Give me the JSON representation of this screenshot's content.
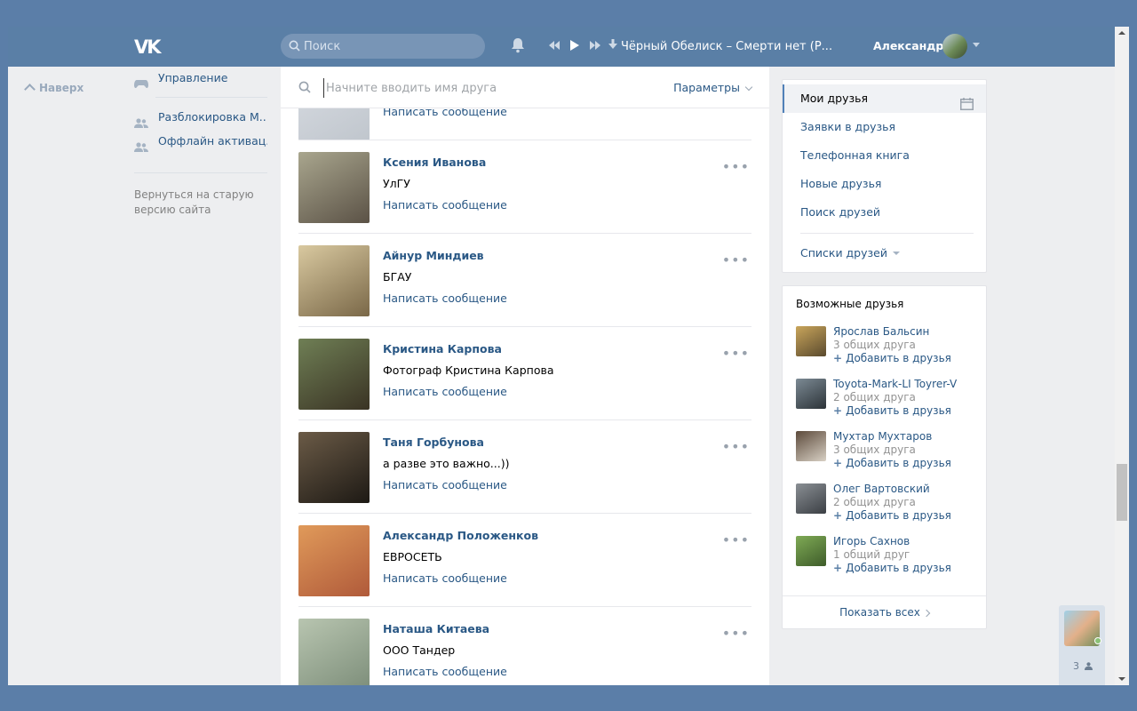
{
  "header": {
    "logo": "VK",
    "search_placeholder": "Поиск",
    "track": "Чёрный Обелиск – Смерти нет (Р...",
    "username": "Александр"
  },
  "left_menu": {
    "back_to_top": "Наверх",
    "items": [
      {
        "label": "Управление",
        "icon": "gamepad-icon"
      },
      {
        "label": "Разблокировка М..",
        "icon": "people-icon"
      },
      {
        "label": "Оффлайн активац..",
        "icon": "people-icon"
      }
    ],
    "old_site": "Вернуться на старую версию сайта"
  },
  "friends_filter": {
    "placeholder": "Начните вводить имя друга",
    "params_label": "Параметры"
  },
  "friends": [
    {
      "name": "",
      "subtitle": "",
      "message": "Написать сообщение",
      "photo": [
        "#d8dce2",
        "#c0c6cd"
      ]
    },
    {
      "name": "Ксения Иванова",
      "subtitle": "УлГУ",
      "message": "Написать сообщение",
      "more": "•••",
      "photo": [
        "#a9a68e",
        "#5b5246"
      ]
    },
    {
      "name": "Айнур Миндиев",
      "subtitle": "БГАУ",
      "message": "Написать сообщение",
      "more": "•••",
      "photo": [
        "#d9c9a0",
        "#7a6848"
      ]
    },
    {
      "name": "Кристина Карпова",
      "subtitle": "Фотограф Кристина Карпова",
      "message": "Написать сообщение",
      "more": "•••",
      "photo": [
        "#6f7f55",
        "#3a3324"
      ]
    },
    {
      "name": "Таня Горбунова",
      "subtitle": "а разве это важно...))",
      "message": "Написать сообщение",
      "more": "•••",
      "photo": [
        "#6b5b47",
        "#1d1914"
      ]
    },
    {
      "name": "Александр Положенков",
      "subtitle": "ЕВРОСЕТЬ",
      "message": "Написать сообщение",
      "more": "•••",
      "photo": [
        "#e09a5a",
        "#b05a3a"
      ]
    },
    {
      "name": "Наташа Китаева",
      "subtitle": "ООО Тандер",
      "message": "Написать сообщение",
      "more": "•••",
      "photo": [
        "#b8c5b0",
        "#7d8e7a"
      ]
    }
  ],
  "right_nav": {
    "items": [
      {
        "label": "Мои друзья",
        "active": true
      },
      {
        "label": "Заявки в друзья"
      },
      {
        "label": "Телефонная книга"
      },
      {
        "label": "Новые друзья"
      },
      {
        "label": "Поиск друзей"
      }
    ],
    "lists_label": "Списки друзей"
  },
  "possible_friends": {
    "title": "Возможные друзья",
    "items": [
      {
        "name": "Ярослав Бальсин",
        "common": "3 общих друга",
        "add": "Добавить в друзья",
        "photo": [
          "#c9a55b",
          "#5a4a2e"
        ]
      },
      {
        "name": "Toyota-Mark-LI Toyrer-V",
        "common": "2 общих друга",
        "add": "Добавить в друзья",
        "photo": [
          "#7c8a94",
          "#2c3338"
        ]
      },
      {
        "name": "Мухтар Мухтаров",
        "common": "3 общих друга",
        "add": "Добавить в друзья",
        "photo": [
          "#5c4a3b",
          "#d8d0c4"
        ]
      },
      {
        "name": "Олег Вартовский",
        "common": "2 общих друга",
        "add": "Добавить в друзья",
        "photo": [
          "#8a8f94",
          "#3b3f44"
        ]
      },
      {
        "name": "Игорь Сахнов",
        "common": "1 общий друг",
        "add": "Добавить в друзья",
        "photo": [
          "#7faa55",
          "#3e5c2a"
        ]
      }
    ],
    "show_all": "Показать всех"
  },
  "chat_widget": {
    "count": "3"
  }
}
